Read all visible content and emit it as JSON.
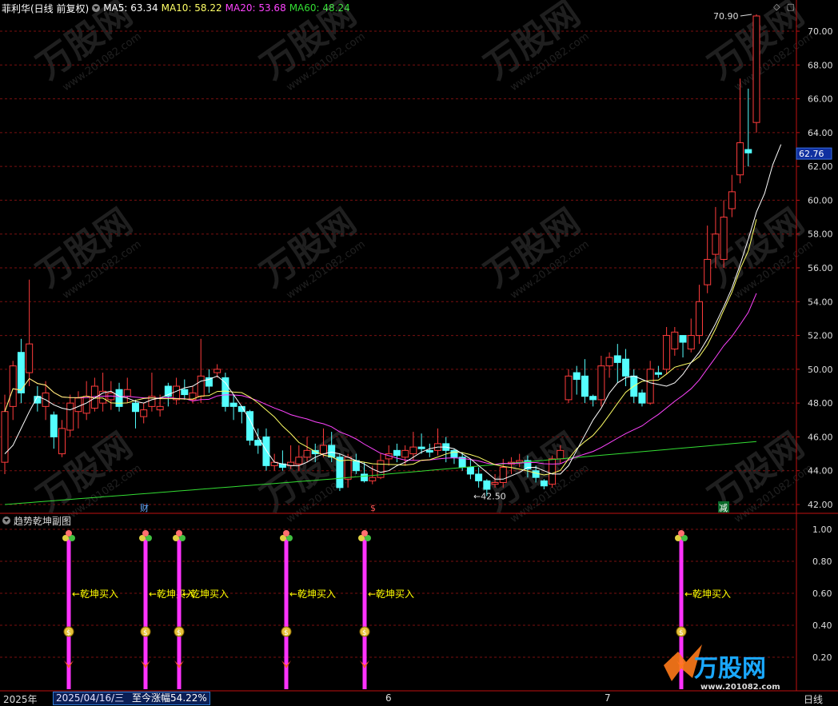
{
  "header": {
    "title": "菲利华(日线 前复权)",
    "ma5": "MA5: 63.34",
    "ma10": "MA10: 58.22",
    "ma20": "MA20: 53.68",
    "ma60": "MA60: 48.24"
  },
  "colors": {
    "up": "#ff3c3c",
    "down": "#54ffff",
    "ma5": "#ffffff",
    "ma10": "#ffff66",
    "ma20": "#ff44ff",
    "ma60": "#33dd33",
    "grid": "#7a1010",
    "axis": "#c01010",
    "signal": "#ff33ff",
    "buy_text": "#ffff00"
  },
  "main_axis": {
    "ticks": [
      "70.00",
      "68.00",
      "66.00",
      "64.00",
      "62.00",
      "60.00",
      "58.00",
      "56.00",
      "54.00",
      "52.00",
      "50.00",
      "48.00",
      "46.00",
      "44.00",
      "42.00"
    ],
    "current_price": "62.76",
    "high_label": "70.90",
    "low_label": "42.50"
  },
  "badges": {
    "cai": "财",
    "money": "$",
    "jian": "减"
  },
  "chart_data": {
    "type": "candlestick",
    "ylim": [
      41.5,
      71.5
    ],
    "candles": [
      [
        44.5,
        47.5,
        43.8,
        48.5
      ],
      [
        47.8,
        50.2,
        47.0,
        50.5
      ],
      [
        51.0,
        48.6,
        48.0,
        51.8
      ],
      [
        49.8,
        51.5,
        49.0,
        55.3
      ],
      [
        48.4,
        48.0,
        47.5,
        49.0
      ],
      [
        47.8,
        48.6,
        47.0,
        49.3
      ],
      [
        47.3,
        46.0,
        45.3,
        47.5
      ],
      [
        45.0,
        46.5,
        44.8,
        47.0
      ],
      [
        46.4,
        48.0,
        46.0,
        48.5
      ],
      [
        47.5,
        48.3,
        46.5,
        48.7
      ],
      [
        47.4,
        48.4,
        47.0,
        49.3
      ],
      [
        47.7,
        49.0,
        47.5,
        49.5
      ],
      [
        48.0,
        48.7,
        47.5,
        49.8
      ],
      [
        48.2,
        48.6,
        47.6,
        49.3
      ],
      [
        48.8,
        47.8,
        47.5,
        49.2
      ],
      [
        48.4,
        48.8,
        48.0,
        49.5
      ],
      [
        48.0,
        47.5,
        46.5,
        48.2
      ],
      [
        47.2,
        47.6,
        46.8,
        48.0
      ],
      [
        47.8,
        48.4,
        47.5,
        49.8
      ],
      [
        47.6,
        47.8,
        47.2,
        48.5
      ],
      [
        49.0,
        48.4,
        47.8,
        49.2
      ],
      [
        48.2,
        49.0,
        47.9,
        49.5
      ],
      [
        48.8,
        48.5,
        48.2,
        49.4
      ],
      [
        48.2,
        48.6,
        48.0,
        49.0
      ],
      [
        48.4,
        49.6,
        48.0,
        51.8
      ],
      [
        49.5,
        49.0,
        48.6,
        50.0
      ],
      [
        49.8,
        50.0,
        49.5,
        50.3
      ],
      [
        49.5,
        47.8,
        47.5,
        49.8
      ],
      [
        48.0,
        47.8,
        47.0,
        48.5
      ],
      [
        47.8,
        47.5,
        46.8,
        47.8
      ],
      [
        47.5,
        45.8,
        45.5,
        47.6
      ],
      [
        45.8,
        45.5,
        45.0,
        46.5
      ],
      [
        46.0,
        44.3,
        44.0,
        46.5
      ],
      [
        44.3,
        44.5,
        44.0,
        45.0
      ],
      [
        44.4,
        44.2,
        44.0,
        45.2
      ],
      [
        44.3,
        44.5,
        44.1,
        45.5
      ],
      [
        44.4,
        44.8,
        44.0,
        45.5
      ],
      [
        44.8,
        45.2,
        44.5,
        46.0
      ],
      [
        45.2,
        45.0,
        44.5,
        45.6
      ],
      [
        45.0,
        45.5,
        44.8,
        46.5
      ],
      [
        45.5,
        44.8,
        44.5,
        46.3
      ],
      [
        44.8,
        43.0,
        42.8,
        45.0
      ],
      [
        43.5,
        44.8,
        43.0,
        45.0
      ],
      [
        44.6,
        44.0,
        43.8,
        45.0
      ],
      [
        43.8,
        43.4,
        43.3,
        44.5
      ],
      [
        43.4,
        43.6,
        43.2,
        44.3
      ],
      [
        43.6,
        44.6,
        43.5,
        45.0
      ],
      [
        44.7,
        45.0,
        44.3,
        45.5
      ],
      [
        45.2,
        44.9,
        44.5,
        45.6
      ],
      [
        44.8,
        45.2,
        44.3,
        45.5
      ],
      [
        45.0,
        45.4,
        44.6,
        46.3
      ],
      [
        45.4,
        45.3,
        45.0,
        46.2
      ],
      [
        45.2,
        45.1,
        44.8,
        45.6
      ],
      [
        45.2,
        45.6,
        44.9,
        46.5
      ],
      [
        45.6,
        45.2,
        44.5,
        46.0
      ],
      [
        45.2,
        44.8,
        44.4,
        45.3
      ],
      [
        44.8,
        44.2,
        44.0,
        45.1
      ],
      [
        44.2,
        43.8,
        43.5,
        44.7
      ],
      [
        43.8,
        43.4,
        43.0,
        44.2
      ],
      [
        43.4,
        42.9,
        42.5,
        43.5
      ],
      [
        43.2,
        43.3,
        43.0,
        43.8
      ],
      [
        43.3,
        44.2,
        43.0,
        44.7
      ],
      [
        44.4,
        44.5,
        43.8,
        44.8
      ],
      [
        44.5,
        44.6,
        44.2,
        45.0
      ],
      [
        44.6,
        44.1,
        43.6,
        44.9
      ],
      [
        44.0,
        43.6,
        43.3,
        44.3
      ],
      [
        43.4,
        43.1,
        42.9,
        43.5
      ],
      [
        43.2,
        44.7,
        43.0,
        44.9
      ],
      [
        44.7,
        45.2,
        44.4,
        45.5
      ],
      [
        48.2,
        49.6,
        48.0,
        50.0
      ],
      [
        49.8,
        49.4,
        48.5,
        50.2
      ],
      [
        49.6,
        48.4,
        48.0,
        50.6
      ],
      [
        48.4,
        48.2,
        47.8,
        48.5
      ],
      [
        48.2,
        50.2,
        47.8,
        50.8
      ],
      [
        50.2,
        50.7,
        49.5,
        51.0
      ],
      [
        50.8,
        50.4,
        49.2,
        51.5
      ],
      [
        50.6,
        49.6,
        49.0,
        51.2
      ],
      [
        49.6,
        48.4,
        48.0,
        50.0
      ],
      [
        48.6,
        48.0,
        47.8,
        48.8
      ],
      [
        48.0,
        50.0,
        47.9,
        50.5
      ],
      [
        49.8,
        49.7,
        49.5,
        50.2
      ],
      [
        50.0,
        52.0,
        49.7,
        52.5
      ],
      [
        51.2,
        52.2,
        50.8,
        52.5
      ],
      [
        52.0,
        51.6,
        50.7,
        51.8
      ],
      [
        51.2,
        52.0,
        51.0,
        53.0
      ],
      [
        52.0,
        54.0,
        51.5,
        55.0
      ],
      [
        55.0,
        56.5,
        54.5,
        58.5
      ],
      [
        56.8,
        58.0,
        56.0,
        59.6
      ],
      [
        56.5,
        59.0,
        56.0,
        60.0
      ],
      [
        59.5,
        60.5,
        59.0,
        61.5
      ],
      [
        61.5,
        63.4,
        61.0,
        67.2
      ],
      [
        63.0,
        62.8,
        62.0,
        66.6
      ],
      [
        64.6,
        70.9,
        64.0,
        71.0
      ]
    ],
    "ma5": [
      45.0,
      45.5,
      46.5,
      47.5,
      48.4,
      48.2,
      47.9,
      47.7,
      47.6,
      47.8,
      48.0,
      48.3,
      48.6,
      48.7,
      48.4,
      48.3,
      48.1,
      48.0,
      48.2,
      48.3,
      48.5,
      48.7,
      48.9,
      49.0,
      49.3,
      49.4,
      49.6,
      49.2,
      48.5,
      47.8,
      47.0,
      46.0,
      45.2,
      44.5,
      44.4,
      44.3,
      44.3,
      44.5,
      44.8,
      45.0,
      45.1,
      45.0,
      44.8,
      44.6,
      44.4,
      44.1,
      43.9,
      44.0,
      44.3,
      44.5,
      44.8,
      45.1,
      45.3,
      45.4,
      45.4,
      45.3,
      45.0,
      44.7,
      44.3,
      43.9,
      43.5,
      43.5,
      43.7,
      43.9,
      44.2,
      44.2,
      44.0,
      43.8,
      43.8,
      44.3,
      45.2,
      46.1,
      47.0,
      47.7,
      48.6,
      49.2,
      49.5,
      49.6,
      49.4,
      49.2,
      49.1,
      49.0,
      49.2,
      49.7,
      50.4,
      51.0,
      51.8,
      52.7,
      53.7,
      54.8,
      56.2,
      57.7,
      59.3,
      60.4,
      62.1,
      63.3
    ]
  },
  "signal": {
    "title": "趋势乾坤副图",
    "buy_label": "←乾坤买入",
    "axis_ticks": [
      "1.00",
      "0.80",
      "0.60",
      "0.40",
      "0.20"
    ]
  },
  "footer": {
    "year": "2025年",
    "date": "2025/04/16/三",
    "change": "至今涨幅54.22%",
    "month_6": "6",
    "month_7": "7",
    "period": "日线"
  },
  "watermark": {
    "text": "万股网",
    "url": "www.201082.com"
  },
  "logo": {
    "name": "万股网",
    "url": "www.201082.com"
  }
}
